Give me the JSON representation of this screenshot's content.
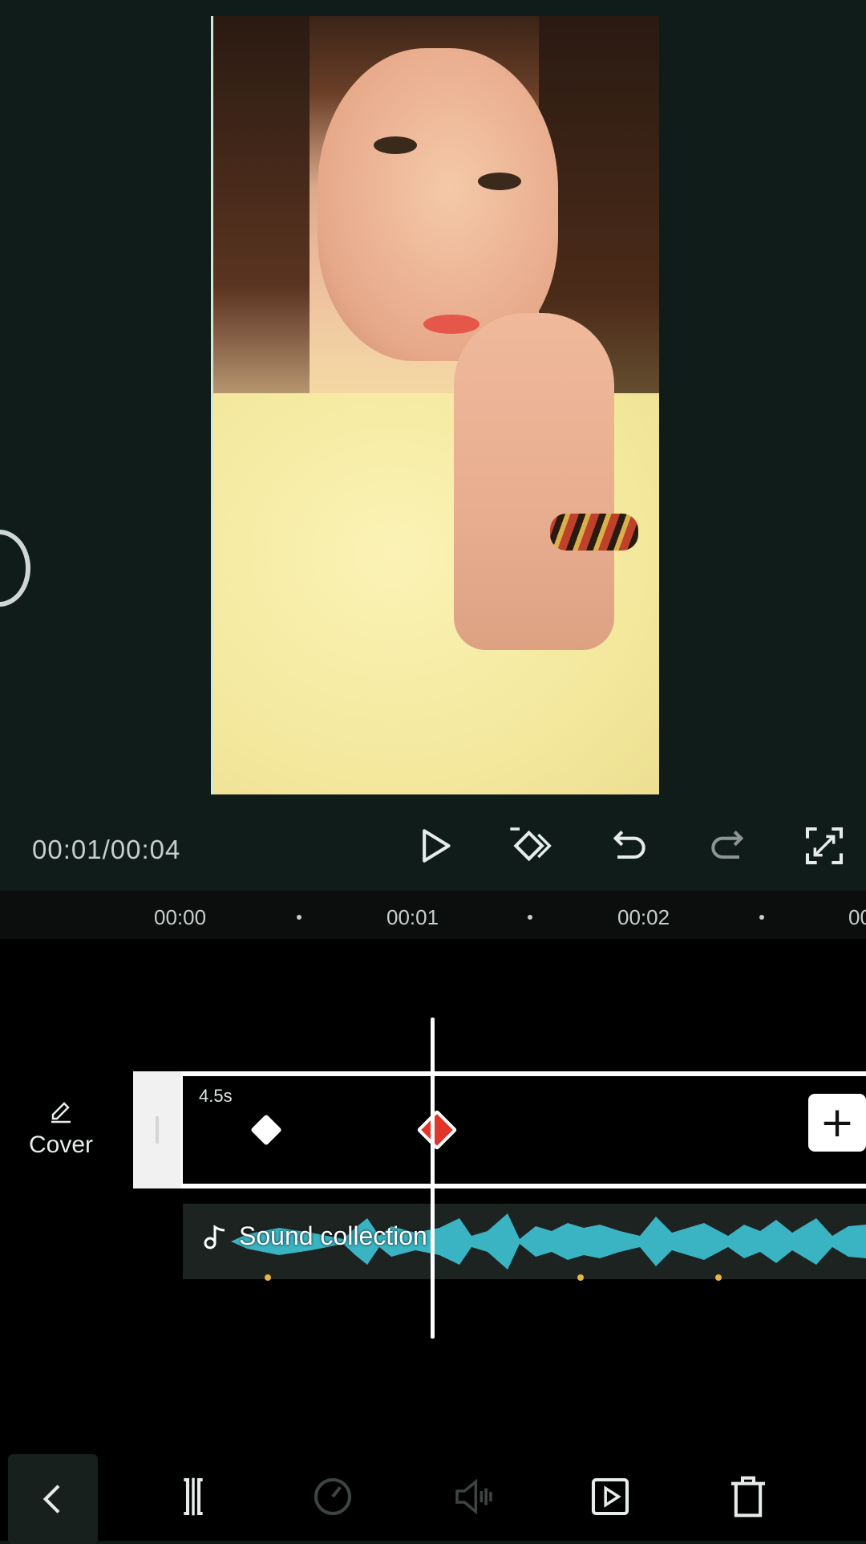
{
  "preview": {
    "time_current": "00:01",
    "time_total": "00:04",
    "time_readout": "00:01/00:04"
  },
  "controls": {
    "icons": [
      "play-icon",
      "add-keyframe-icon",
      "undo-icon",
      "redo-icon",
      "fullscreen-icon"
    ]
  },
  "ruler": {
    "labels": [
      "00:00",
      "00:01",
      "00:02",
      "00"
    ]
  },
  "timeline": {
    "cover_label": "Cover",
    "clip_duration": "4.5s",
    "audio_label": "Sound collection",
    "keyframe_color_active": "#e0352b",
    "waveform_color": "#3ab3c2"
  },
  "toolbar": {
    "icons": [
      "back-icon",
      "split-icon",
      "speed-icon",
      "volume-icon",
      "animation-icon",
      "delete-icon"
    ]
  }
}
